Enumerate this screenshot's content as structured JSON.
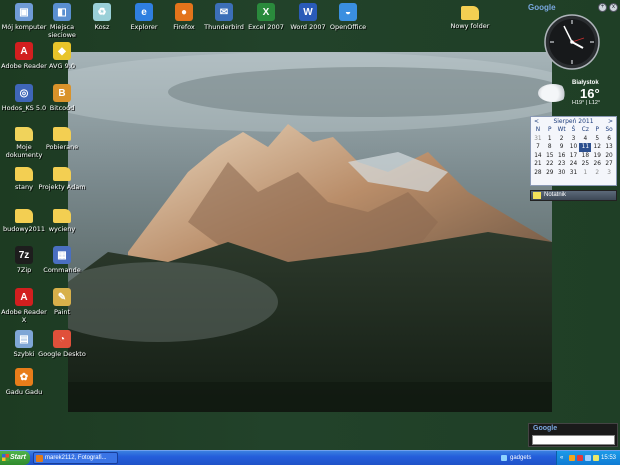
{
  "desktop": {
    "icons": [
      {
        "label": "Mój komputer",
        "icon": "computer-icon",
        "color": "#6f9bd6"
      },
      {
        "label": "Miejsca sieciowe",
        "icon": "network-icon",
        "color": "#5a8fd0"
      },
      {
        "label": "Kosz",
        "icon": "recycle-bin-icon",
        "color": "#9ad0d8"
      },
      {
        "label": "Explorer",
        "icon": "internet-explorer-icon",
        "color": "#2f7fe0"
      },
      {
        "label": "Firefox",
        "icon": "firefox-icon",
        "color": "#e3741b"
      },
      {
        "label": "Thunderbird",
        "icon": "thunderbird-icon",
        "color": "#3c6fb8"
      },
      {
        "label": "Excel 2007",
        "icon": "excel-icon",
        "color": "#2a8a3c"
      },
      {
        "label": "Word 2007",
        "icon": "word-icon",
        "color": "#2a5bb8"
      },
      {
        "label": "OpenOffice",
        "icon": "openoffice-icon",
        "color": "#3a8fe0"
      },
      {
        "label": "Nowy folder",
        "icon": "folder-icon",
        "color": "#f3cf52"
      },
      {
        "label": "Adobe Reader",
        "icon": "adobe-reader-icon",
        "color": "#d21f1f"
      },
      {
        "label": "AVG 9.0",
        "icon": "avg-icon",
        "color": "#e8c42a"
      },
      {
        "label": "Hodos_KS 5.0",
        "icon": "app-icon",
        "color": "#3f66b8"
      },
      {
        "label": "Bitcoód",
        "icon": "bitcomet-icon",
        "color": "#d9922a"
      },
      {
        "label": "Moje dokumenty",
        "icon": "my-documents-icon",
        "color": "#f0d35b"
      },
      {
        "label": "Pobierane",
        "icon": "folder-icon",
        "color": "#f3cf52"
      },
      {
        "label": "stany",
        "icon": "folder-icon",
        "color": "#f3cf52"
      },
      {
        "label": "Projekty Adam",
        "icon": "folder-shortcut-icon",
        "color": "#f3cf52"
      },
      {
        "label": "budowy2011",
        "icon": "folder-icon",
        "color": "#f3cf52"
      },
      {
        "label": "wycieny",
        "icon": "folder-icon",
        "color": "#f3cf52"
      },
      {
        "label": "7Zip",
        "icon": "7zip-icon",
        "color": "#1d1d1d"
      },
      {
        "label": "Commande",
        "icon": "commander-icon",
        "color": "#4a6fc0"
      },
      {
        "label": "Adobe Reader X",
        "icon": "adobe-reader-icon",
        "color": "#d21f1f"
      },
      {
        "label": "Paint",
        "icon": "paint-icon",
        "color": "#d8b04a"
      },
      {
        "label": "Szybki",
        "icon": "app-window-icon",
        "color": "#7fa6d6"
      },
      {
        "label": "Google Deskto",
        "icon": "google-desktop-icon",
        "color": "#e0503a"
      },
      {
        "label": "Gadu Gadu",
        "icon": "gadu-gadu-icon",
        "color": "#e87d1a"
      }
    ]
  },
  "gadgets": {
    "google_top": "Google",
    "controls": [
      "+",
      "x"
    ],
    "weather": {
      "city": "Białystok",
      "temperature": "16°",
      "range": "H19° | L12°"
    },
    "calendar": {
      "prev": "<",
      "next": ">",
      "month": "Sierpeń 2011",
      "day_headers": [
        "N",
        "P",
        "Wt",
        "Ś",
        "Cz",
        "P",
        "So"
      ],
      "days": [
        {
          "d": "31",
          "other": true
        },
        {
          "d": "1"
        },
        {
          "d": "2"
        },
        {
          "d": "3"
        },
        {
          "d": "4"
        },
        {
          "d": "5"
        },
        {
          "d": "6"
        },
        {
          "d": "7"
        },
        {
          "d": "8"
        },
        {
          "d": "9"
        },
        {
          "d": "10"
        },
        {
          "d": "11",
          "today": true
        },
        {
          "d": "12"
        },
        {
          "d": "13"
        },
        {
          "d": "14"
        },
        {
          "d": "15"
        },
        {
          "d": "16"
        },
        {
          "d": "17"
        },
        {
          "d": "18"
        },
        {
          "d": "19"
        },
        {
          "d": "20"
        },
        {
          "d": "21"
        },
        {
          "d": "22"
        },
        {
          "d": "23"
        },
        {
          "d": "24"
        },
        {
          "d": "25"
        },
        {
          "d": "26"
        },
        {
          "d": "27"
        },
        {
          "d": "28"
        },
        {
          "d": "29"
        },
        {
          "d": "30"
        },
        {
          "d": "31"
        },
        {
          "d": "1",
          "other": true
        },
        {
          "d": "2",
          "other": true
        },
        {
          "d": "3",
          "other": true
        }
      ]
    },
    "notes_label": "Notatnik",
    "google_search": {
      "logo": "Google",
      "value": ""
    }
  },
  "taskbar": {
    "start_label": "Start",
    "task_label": "marek2112, Fotografi...",
    "gadgets_label": "gadgets",
    "tray_arrow": "«",
    "time": "15:53"
  },
  "colors": {
    "desktop_bg": "#22422a",
    "taskbar": "#245edb",
    "start_button": "#3a9a35",
    "calendar_today": "#2c4f8f"
  }
}
